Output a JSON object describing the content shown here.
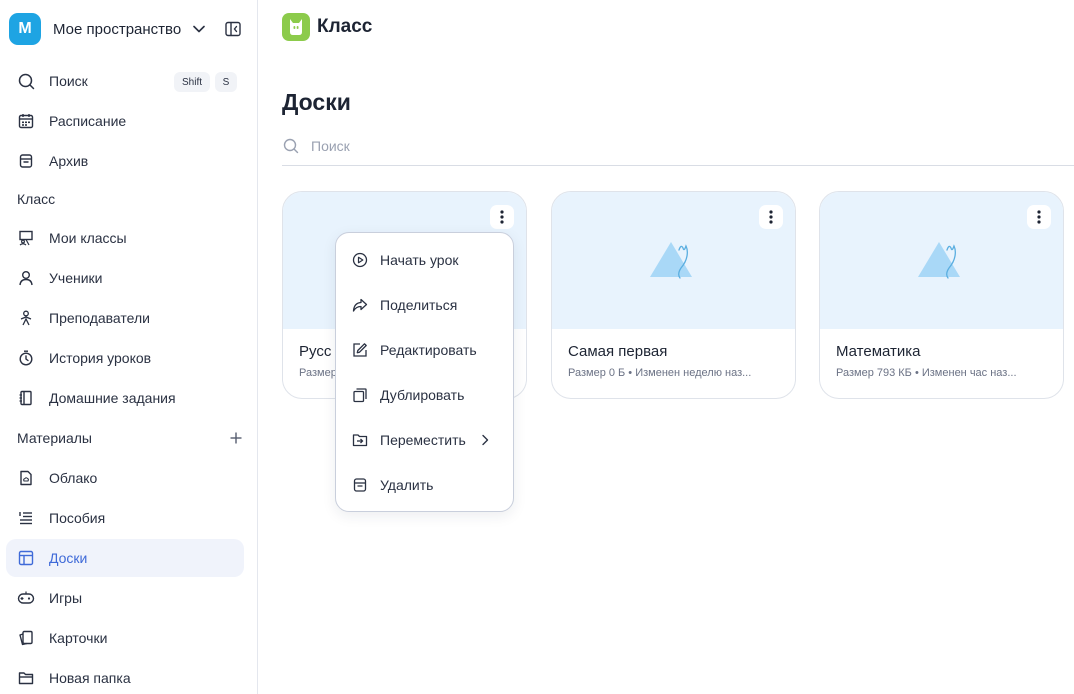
{
  "workspace": {
    "avatar_letter": "M",
    "name": "Мое пространство"
  },
  "sidebar": {
    "top_items": [
      {
        "label": "Поиск",
        "icon": "search-icon",
        "shortcut": [
          "Shift",
          "S"
        ]
      },
      {
        "label": "Расписание",
        "icon": "calendar-icon"
      },
      {
        "label": "Архив",
        "icon": "archive-icon"
      }
    ],
    "class_section": {
      "title": "Класс",
      "items": [
        {
          "label": "Мои классы",
          "icon": "classroom-icon"
        },
        {
          "label": "Ученики",
          "icon": "user-icon"
        },
        {
          "label": "Преподаватели",
          "icon": "teacher-icon"
        },
        {
          "label": "История уроков",
          "icon": "timer-icon"
        },
        {
          "label": "Домашние задания",
          "icon": "notebook-icon"
        }
      ]
    },
    "materials_section": {
      "title": "Материалы",
      "items": [
        {
          "label": "Облако",
          "icon": "cloud-file-icon"
        },
        {
          "label": "Пособия",
          "icon": "list-icon"
        },
        {
          "label": "Доски",
          "icon": "board-icon",
          "active": true
        },
        {
          "label": "Игры",
          "icon": "gamepad-icon"
        },
        {
          "label": "Карточки",
          "icon": "cards-icon"
        },
        {
          "label": "Новая папка",
          "icon": "folder-icon"
        }
      ]
    }
  },
  "brand": {
    "name": "Класс",
    "color": "#8ccb4b"
  },
  "page": {
    "title": "Доски",
    "search_placeholder": "Поиск"
  },
  "boards": [
    {
      "title": "Русский",
      "title_visible": "Русс",
      "meta": "Размер",
      "size": "",
      "changed": ""
    },
    {
      "title": "Самая первая",
      "meta": "Размер 0 Б • Изменен неделю наз..."
    },
    {
      "title": "Математика",
      "meta": "Размер 793 КБ • Изменен час наз..."
    }
  ],
  "context_menu": {
    "items": [
      {
        "label": "Начать урок",
        "icon": "play-circle-icon"
      },
      {
        "label": "Поделиться",
        "icon": "share-icon"
      },
      {
        "label": "Редактировать",
        "icon": "edit-icon"
      },
      {
        "label": "Дублировать",
        "icon": "duplicate-icon"
      },
      {
        "label": "Переместить",
        "icon": "move-icon",
        "has_submenu": true
      },
      {
        "label": "Удалить",
        "icon": "trash-icon"
      }
    ]
  },
  "colors": {
    "accent": "#3f6ad8",
    "thumb_bg": "#e8f3fd",
    "avatar": "#1ea4e3"
  }
}
